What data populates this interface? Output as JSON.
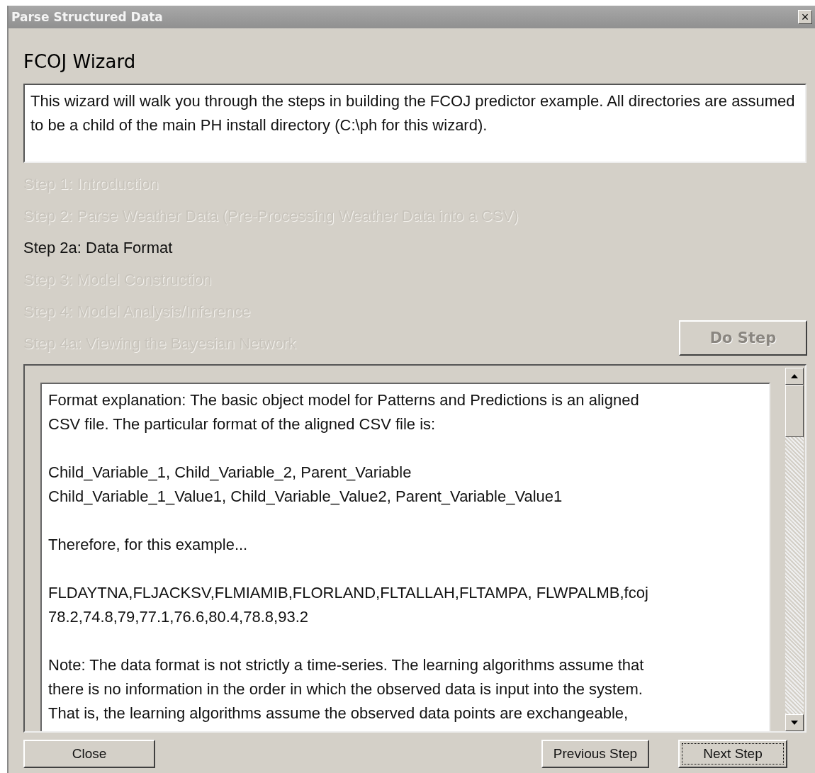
{
  "window": {
    "title": "Parse Structured Data",
    "close_glyph": "×"
  },
  "heading": "FCOJ Wizard",
  "intro": "This wizard will walk you through the steps in building the FCOJ predictor example.  All directories are assumed to be a child of the main PH install directory (C:\\ph for this wizard).",
  "steps": [
    {
      "label": "Step 1: Introduction",
      "selected": false
    },
    {
      "label": "Step 2: Parse Weather Data (Pre-Processing Weather Data into a CSV)",
      "selected": false
    },
    {
      "label": "Step 2a: Data Format",
      "selected": true
    },
    {
      "label": "Step 3: Model Construction",
      "selected": false
    },
    {
      "label": "Step 4: Model Analysis/Inference",
      "selected": false
    },
    {
      "label": "Step 4a: Viewing the Bayesian Network",
      "selected": false
    }
  ],
  "do_step": {
    "label": "Do Step",
    "disabled": true
  },
  "content": [
    [
      "Format explanation: The basic object model for Patterns and Predictions is  an aligned",
      "CSV file. The particular format of the aligned CSV file is:"
    ],
    [
      "Child_Variable_1, Child_Variable_2, Parent_Variable",
      "Child_Variable_1_Value1, Child_Variable_Value2, Parent_Variable_Value1"
    ],
    [
      "Therefore, for this example..."
    ],
    [
      "FLDAYTNA,FLJACKSV,FLMIAMIB,FLORLAND,FLTALLAH,FLTAMPA, FLWPALMB,fcoj",
      "78.2,74.8,79,77.1,76.6,80.4,78.8,93.2"
    ],
    [
      "Note: The data format is not strictly a time-series. The learning  algorithms assume that",
      "there is no information in the order in which the observed data is input into the system.",
      "That is, the learning algorithms assume the observed data points are exchangeable,"
    ]
  ],
  "buttons": [
    {
      "label": "Close",
      "focused": false
    },
    {
      "label": "Previous Step",
      "focused": false
    },
    {
      "label": "Next Step",
      "focused": true
    }
  ]
}
